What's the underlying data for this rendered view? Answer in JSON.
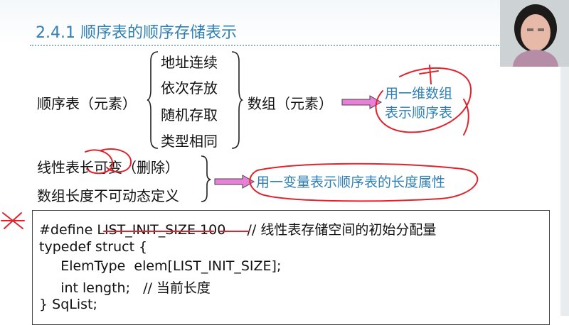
{
  "title": "2.4.1 顺序表的顺序存储表示",
  "row1": {
    "left_label": "顺序表（元素）",
    "properties": [
      "地址连续",
      "依次存放",
      "随机存取",
      "类型相同"
    ],
    "middle_label": "数组（元素）",
    "result": [
      "用一维数组",
      "表示顺序表"
    ]
  },
  "row2": {
    "lines": [
      "线性表长可变（删除）",
      "数组长度不可动态定义"
    ],
    "result": "用一变量表示顺序表的长度属性"
  },
  "code": [
    "#define LIST_INIT_SIZE 100     // 线性表存储空间的初始分配量",
    "typedef struct {",
    "     ElemType  elem[LIST_INIT_SIZE];",
    "     int length;   // 当前长度",
    "} SqList;"
  ],
  "colors": {
    "title": "#2f7fb4",
    "arrow_fill": "#e97fd9",
    "annotation_ink": "#e0242d"
  }
}
